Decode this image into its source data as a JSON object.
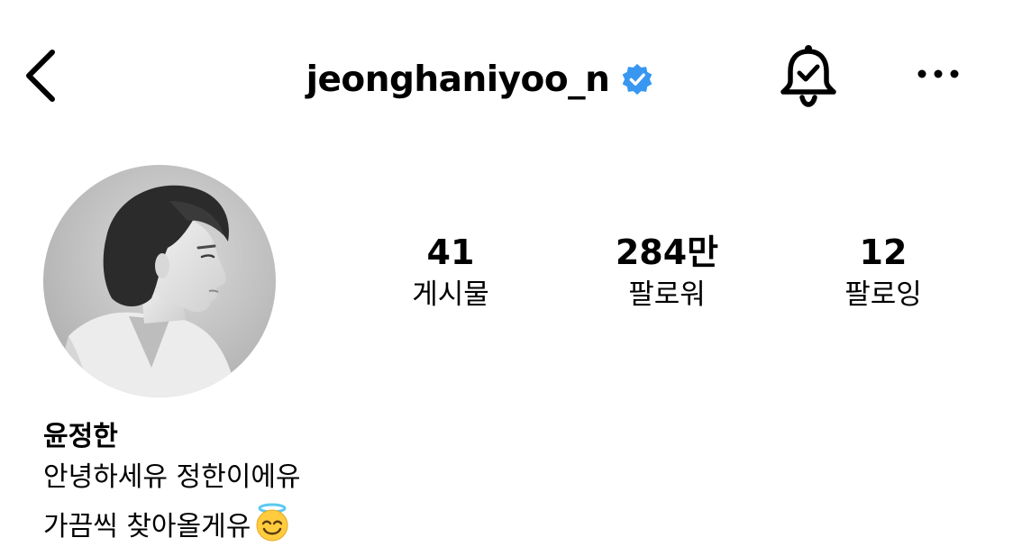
{
  "header": {
    "username": "jeonghaniyoo_n",
    "back_icon": "chevron-left-icon",
    "verified_icon": "verified-badge-icon",
    "notification_icon": "bell-check-icon",
    "more_icon": "more-horizontal-icon",
    "verified_color": "#3897f0"
  },
  "profile": {
    "avatar_description_icon": "avatar",
    "stats": [
      {
        "value": "41",
        "label": "게시물"
      },
      {
        "value": "284만",
        "label": "팔로워"
      },
      {
        "value": "12",
        "label": "팔로잉"
      }
    ],
    "name": "윤정한",
    "bio_lines": [
      "안녕하세유 정한이에유",
      "가끔씩 찾아올게유"
    ],
    "bio_emoji": "smiling-face-with-halo-icon"
  }
}
